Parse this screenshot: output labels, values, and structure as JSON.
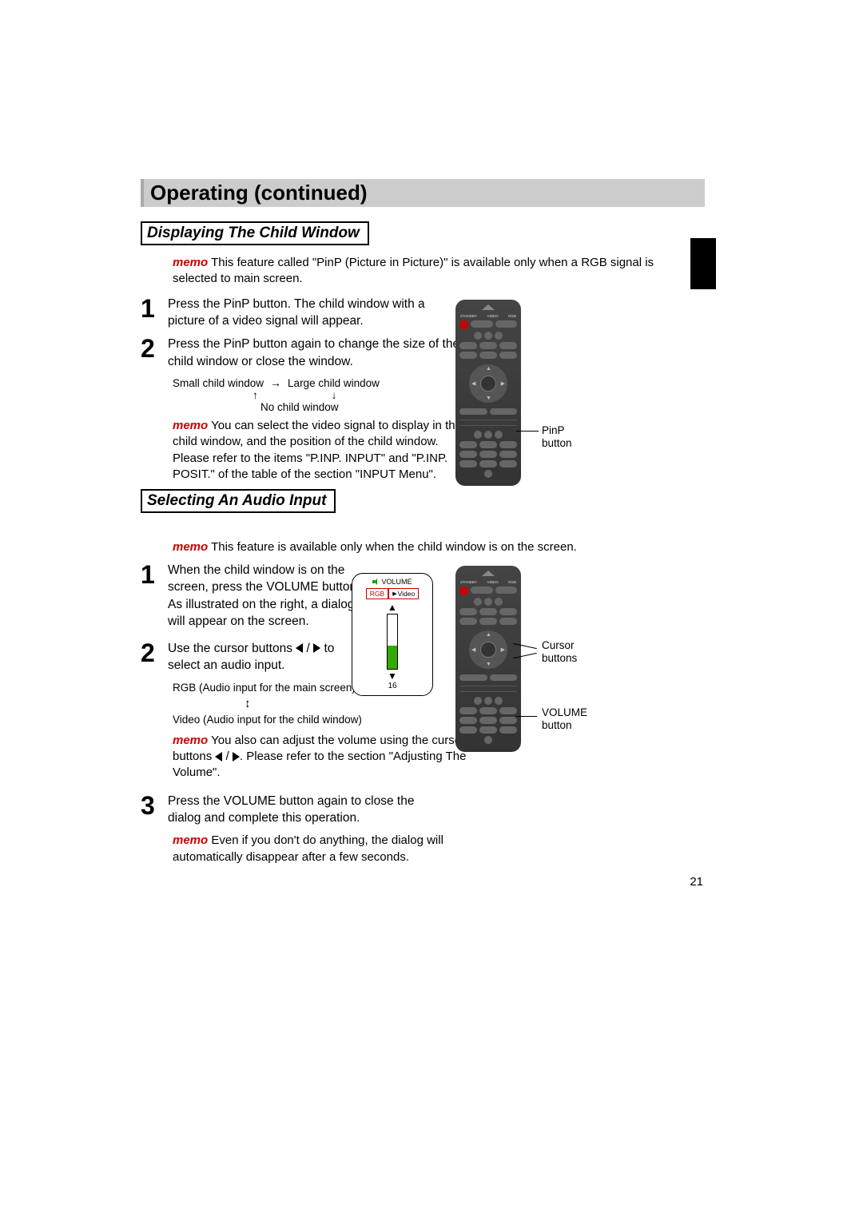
{
  "page_number": "21",
  "title": "Operating (continued)",
  "section_a": {
    "heading": "Displaying The Child Window",
    "intro_memo_label": "memo",
    "intro": "This feature called \"PinP (Picture in Picture)\" is available only when a RGB signal is selected to main screen.",
    "steps": [
      {
        "num": "1",
        "text": "Press the PinP button.\nThe child window with a picture of a video signal will appear."
      },
      {
        "num": "2",
        "text": "Press the PinP button again to change the size of the child window or close the window."
      }
    ],
    "cycle": {
      "left": "Small child window",
      "right": "Large child window",
      "bottom": "No child window"
    },
    "memo2_label": "memo",
    "memo2": "You can select the video signal to display in the child window, and the position of the child window. Please refer to the items \"P.INP. INPUT\" and \"P.INP. POSIT.\" of the table of the section \"INPUT Menu\".",
    "callout_pinp": "PinP button"
  },
  "section_b": {
    "heading": "Selecting An Audio Input",
    "intro_memo_label": "memo",
    "intro": "This feature is available only when the child window is on the screen.",
    "steps": [
      {
        "num": "1",
        "text": "When the child window is on the screen, press the VOLUME button. As illustrated on the right, a dialog will appear on the screen."
      },
      {
        "num": "2",
        "text_pre": "Use the cursor buttons ",
        "text_post": " to select an audio input.",
        "sub_top": "RGB (Audio input for the main screen)",
        "sub_bot": "Video (Audio input for the child window)",
        "memo_label": "memo",
        "memo": "You also can adjust the volume using the cursor buttons ",
        "memo_post": ". Please refer to the section \"Adjusting The Volume\"."
      },
      {
        "num": "3",
        "text": "Press the VOLUME button again to close the dialog and complete this operation.",
        "memo_label": "memo",
        "memo": "Even if you don't do anything, the dialog will automatically disappear after a few seconds."
      }
    ],
    "osd": {
      "title": "VOLUME",
      "rgb": "RGB",
      "video": "Video",
      "value": "16"
    },
    "callout_cursor": "Cursor buttons",
    "callout_volume": "VOLUME button"
  }
}
